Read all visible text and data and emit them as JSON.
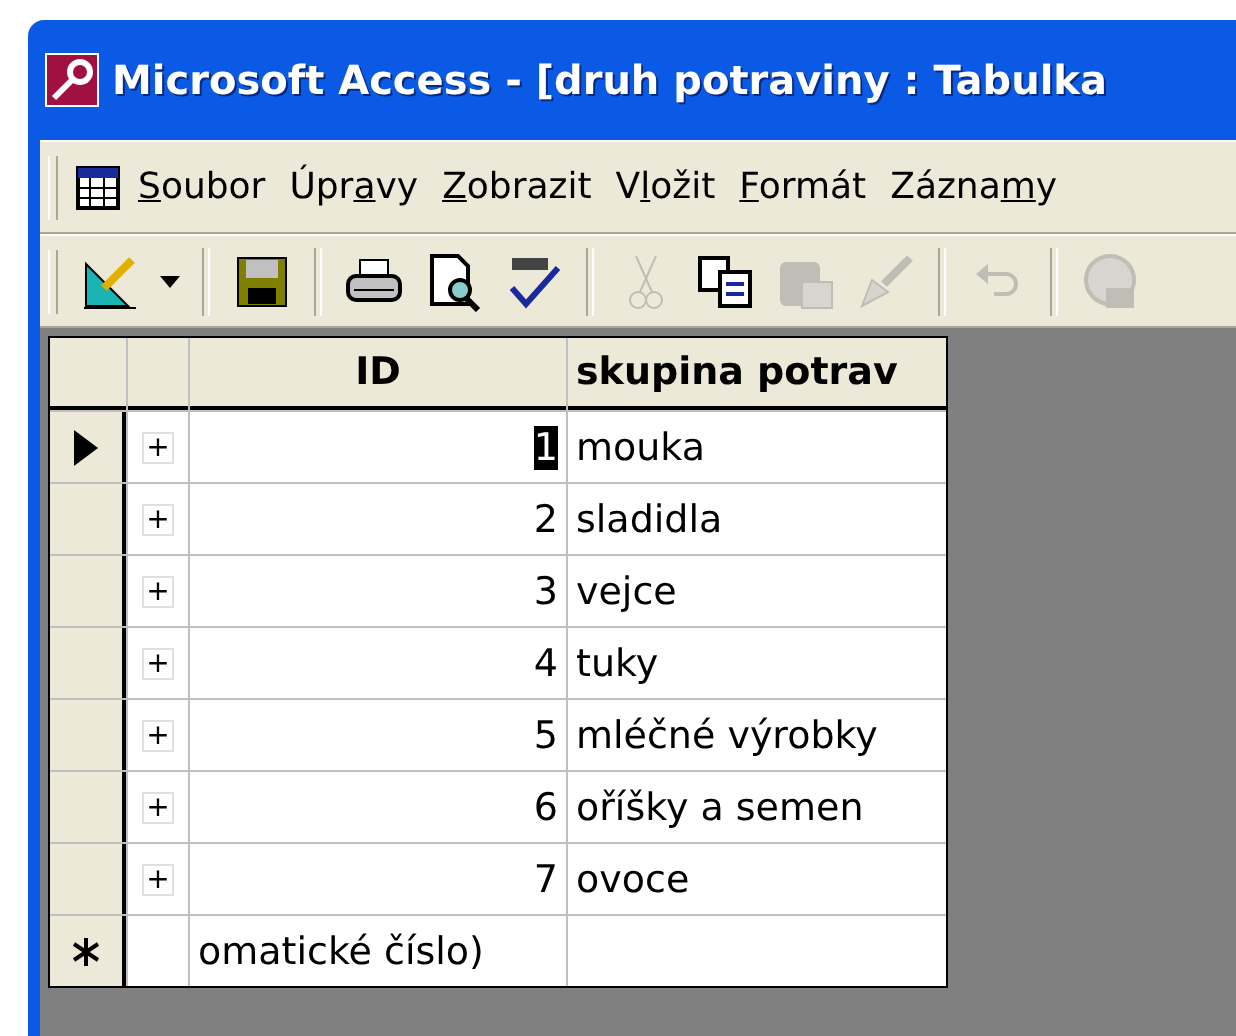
{
  "window": {
    "title": "Microsoft Access - [druh potraviny : Tabulka"
  },
  "menu": [
    {
      "key": "S",
      "after": "oubor"
    },
    {
      "before": "Úpr",
      "key": "a",
      "after": "vy"
    },
    {
      "key": "Z",
      "after": "obrazit"
    },
    {
      "before": "V",
      "key": "l",
      "after": "ožit"
    },
    {
      "key": "F",
      "after": "ormát"
    },
    {
      "before": "Zázna",
      "key": "m",
      "after": "y"
    }
  ],
  "toolbar": [
    {
      "kind": "design",
      "disabled": false
    },
    {
      "kind": "caret",
      "disabled": false
    },
    {
      "kind": "sep"
    },
    {
      "kind": "save",
      "disabled": false
    },
    {
      "kind": "sep"
    },
    {
      "kind": "print",
      "disabled": false
    },
    {
      "kind": "preview",
      "disabled": false
    },
    {
      "kind": "spell",
      "disabled": false
    },
    {
      "kind": "sep"
    },
    {
      "kind": "cut",
      "disabled": true
    },
    {
      "kind": "copy",
      "disabled": false
    },
    {
      "kind": "paste",
      "disabled": true
    },
    {
      "kind": "brush",
      "disabled": true
    },
    {
      "kind": "sep"
    },
    {
      "kind": "undo",
      "disabled": true
    },
    {
      "kind": "sep"
    },
    {
      "kind": "globe",
      "disabled": true
    }
  ],
  "table": {
    "columns": [
      "ID",
      "skupina potrav"
    ],
    "rows": [
      {
        "kind": "record",
        "current": true,
        "expand": "+",
        "id": "1",
        "id_selected": true,
        "name": "mouka"
      },
      {
        "kind": "record",
        "current": false,
        "expand": "+",
        "id": "2",
        "id_selected": false,
        "name": "sladidla"
      },
      {
        "kind": "record",
        "current": false,
        "expand": "+",
        "id": "3",
        "id_selected": false,
        "name": "vejce"
      },
      {
        "kind": "record",
        "current": false,
        "expand": "+",
        "id": "4",
        "id_selected": false,
        "name": "tuky"
      },
      {
        "kind": "record",
        "current": false,
        "expand": "+",
        "id": "5",
        "id_selected": false,
        "name": "mléčné výrobky"
      },
      {
        "kind": "record",
        "current": false,
        "expand": "+",
        "id": "6",
        "id_selected": false,
        "name": "oříšky a semen"
      },
      {
        "kind": "record",
        "current": false,
        "expand": "+",
        "id": "7",
        "id_selected": false,
        "name": "ovoce"
      },
      {
        "kind": "new",
        "current": false,
        "id": "omatické číslo)",
        "id_selected": false
      }
    ]
  }
}
